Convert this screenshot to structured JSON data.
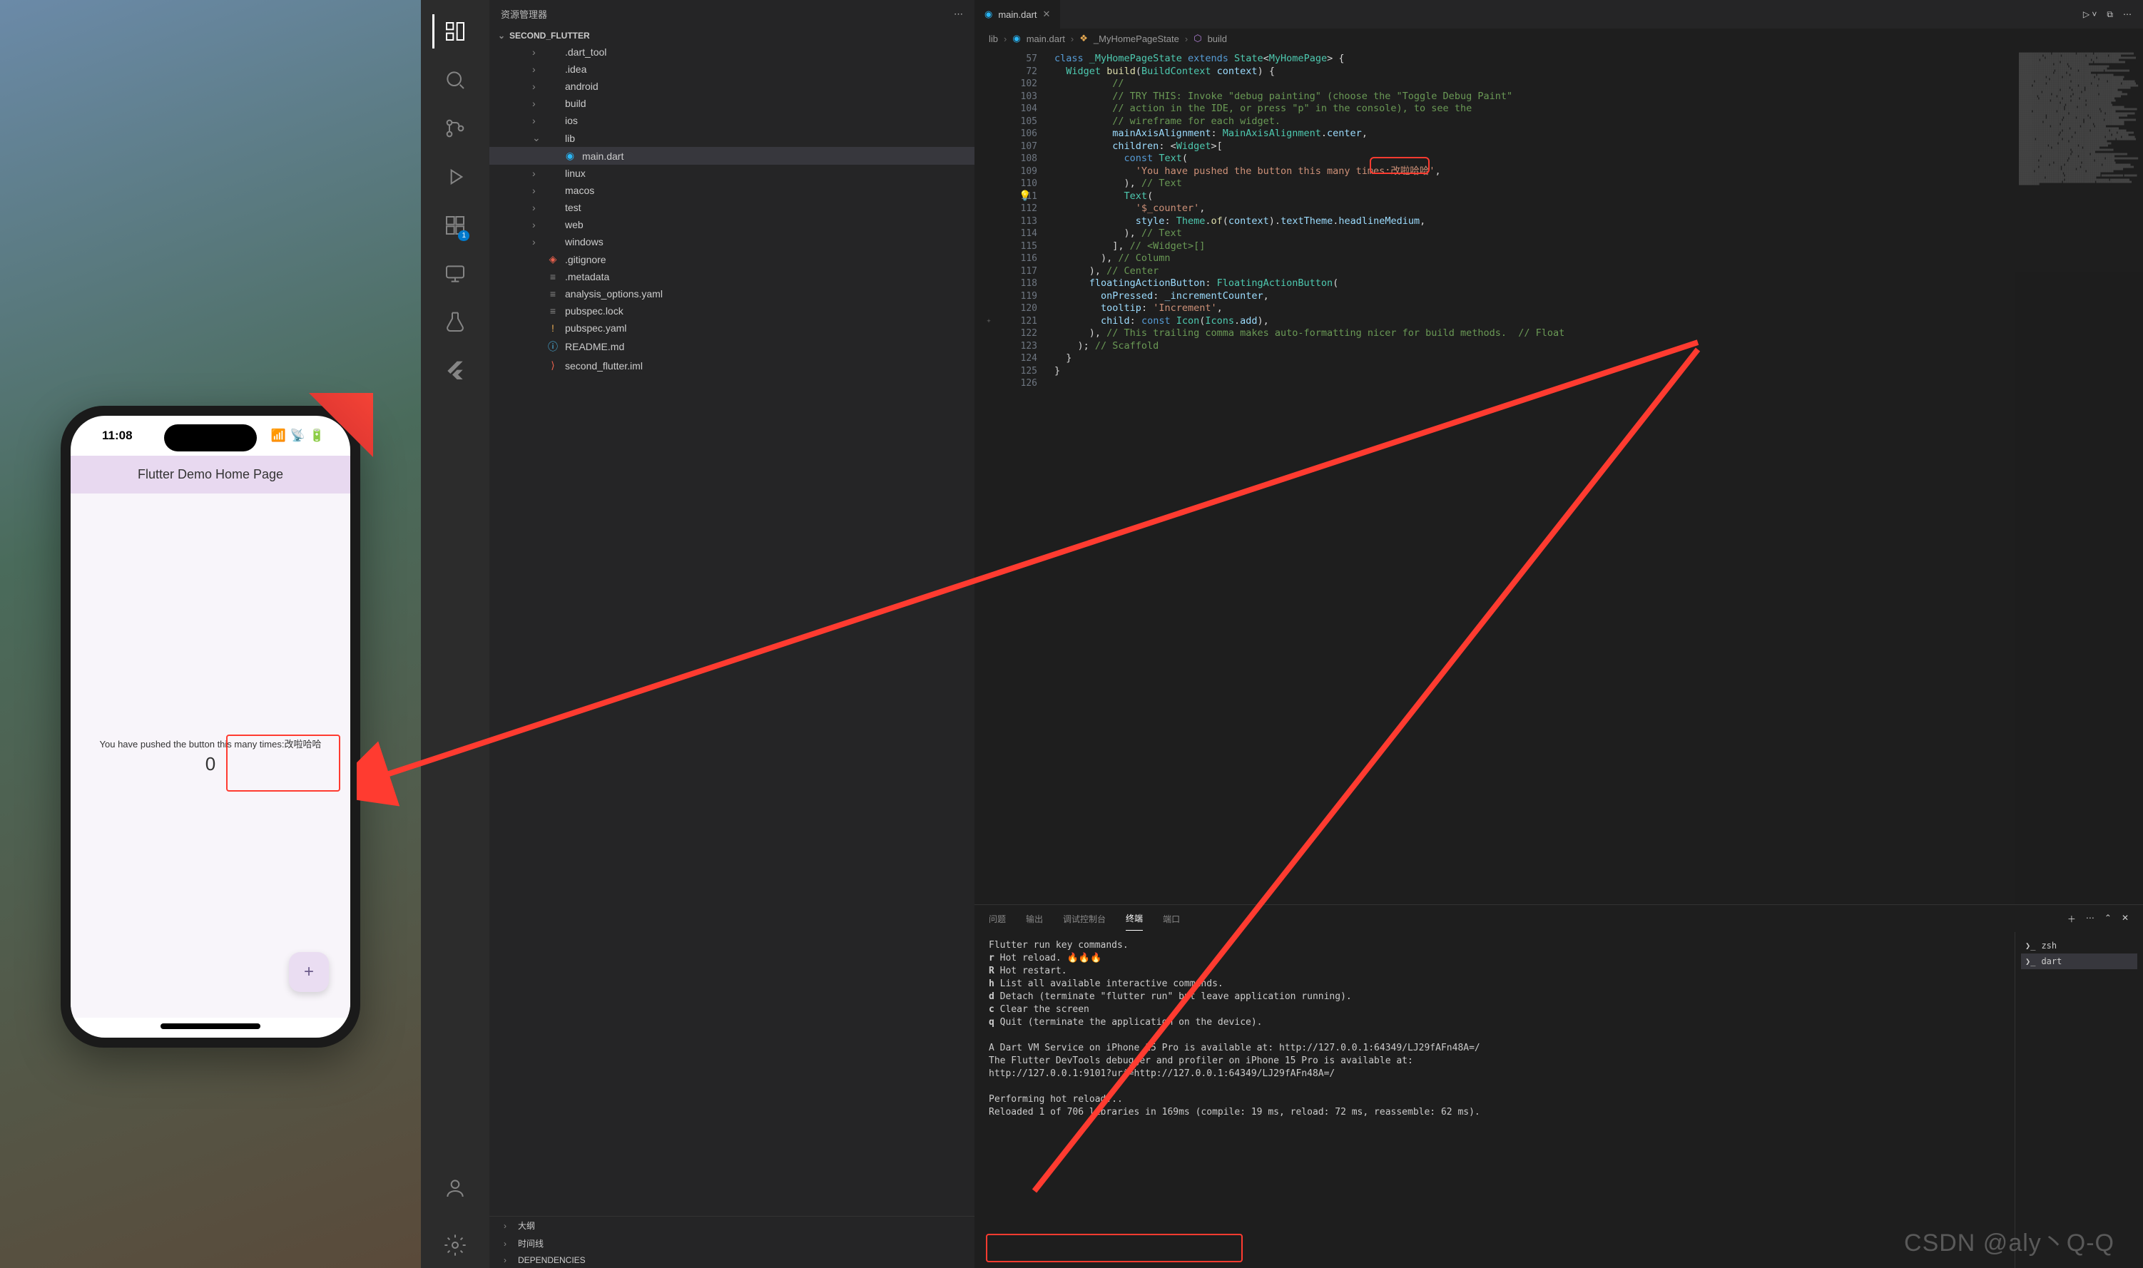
{
  "simulator": {
    "time": "11:08",
    "appbar_title": "Flutter Demo Home Page",
    "body_text": "You have pushed the button this many times:改啦哈哈",
    "counter": "0",
    "fab_label": "+"
  },
  "explorer": {
    "title": "资源管理器",
    "root": "SECOND_FLUTTER",
    "tree": [
      {
        "name": ".dart_tool",
        "type": "folder",
        "depth": 1
      },
      {
        "name": ".idea",
        "type": "folder",
        "depth": 1
      },
      {
        "name": "android",
        "type": "folder",
        "depth": 1
      },
      {
        "name": "build",
        "type": "folder",
        "depth": 1
      },
      {
        "name": "ios",
        "type": "folder",
        "depth": 1
      },
      {
        "name": "lib",
        "type": "folder",
        "depth": 1,
        "expanded": true
      },
      {
        "name": "main.dart",
        "type": "file",
        "depth": 2,
        "icon": "dart",
        "selected": true
      },
      {
        "name": "linux",
        "type": "folder",
        "depth": 1
      },
      {
        "name": "macos",
        "type": "folder",
        "depth": 1
      },
      {
        "name": "test",
        "type": "folder",
        "depth": 1
      },
      {
        "name": "web",
        "type": "folder",
        "depth": 1
      },
      {
        "name": "windows",
        "type": "folder",
        "depth": 1
      },
      {
        "name": ".gitignore",
        "type": "file",
        "depth": 1,
        "icon": "git"
      },
      {
        "name": ".metadata",
        "type": "file",
        "depth": 1,
        "icon": "meta"
      },
      {
        "name": "analysis_options.yaml",
        "type": "file",
        "depth": 1,
        "icon": "yaml"
      },
      {
        "name": "pubspec.lock",
        "type": "file",
        "depth": 1,
        "icon": "lock"
      },
      {
        "name": "pubspec.yaml",
        "type": "file",
        "depth": 1,
        "icon": "yaml-warn"
      },
      {
        "name": "README.md",
        "type": "file",
        "depth": 1,
        "icon": "info"
      },
      {
        "name": "second_flutter.iml",
        "type": "file",
        "depth": 1,
        "icon": "iml"
      }
    ],
    "bottom": [
      "大纲",
      "时间线",
      "DEPENDENCIES"
    ]
  },
  "tab": {
    "filename": "main.dart"
  },
  "breadcrumb": [
    "lib",
    "main.dart",
    "_MyHomePageState",
    "build"
  ],
  "editor": {
    "line_numbers": [
      "57",
      "72",
      "102",
      "103",
      "104",
      "105",
      "106",
      "107",
      "108",
      "109",
      "110",
      "111",
      "112",
      "113",
      "114",
      "115",
      "116",
      "117",
      "118",
      "119",
      "120",
      "121",
      "122",
      "123",
      "124",
      "125",
      "126"
    ],
    "gutter_marks": {
      "121": "+"
    }
  },
  "panel": {
    "tabs": [
      "问题",
      "输出",
      "调试控制台",
      "终端",
      "端口"
    ],
    "active_tab": "终端",
    "sessions": [
      "zsh",
      "dart"
    ],
    "active_session": "dart",
    "output_lines": [
      "Flutter run key commands.",
      "r Hot reload. 🔥🔥🔥",
      "R Hot restart.",
      "h List all available interactive commands.",
      "d Detach (terminate \"flutter run\" but leave application running).",
      "c Clear the screen",
      "q Quit (terminate the application on the device).",
      "",
      "A Dart VM Service on iPhone 15 Pro is available at: http://127.0.0.1:64349/LJ29fAFn48A=/",
      "The Flutter DevTools debugger and profiler on iPhone 15 Pro is available at:",
      "http://127.0.0.1:9101?uri=http://127.0.0.1:64349/LJ29fAFn48A=/",
      "",
      "Performing hot reload...",
      "Reloaded 1 of 706 libraries in 169ms (compile: 19 ms, reload: 72 ms, reassemble: 62 ms)."
    ]
  },
  "watermark": "CSDN @aly丶Q-Q",
  "colors": {
    "accent_red": "#ff3b30",
    "vscode_bg": "#1e1e1e"
  }
}
